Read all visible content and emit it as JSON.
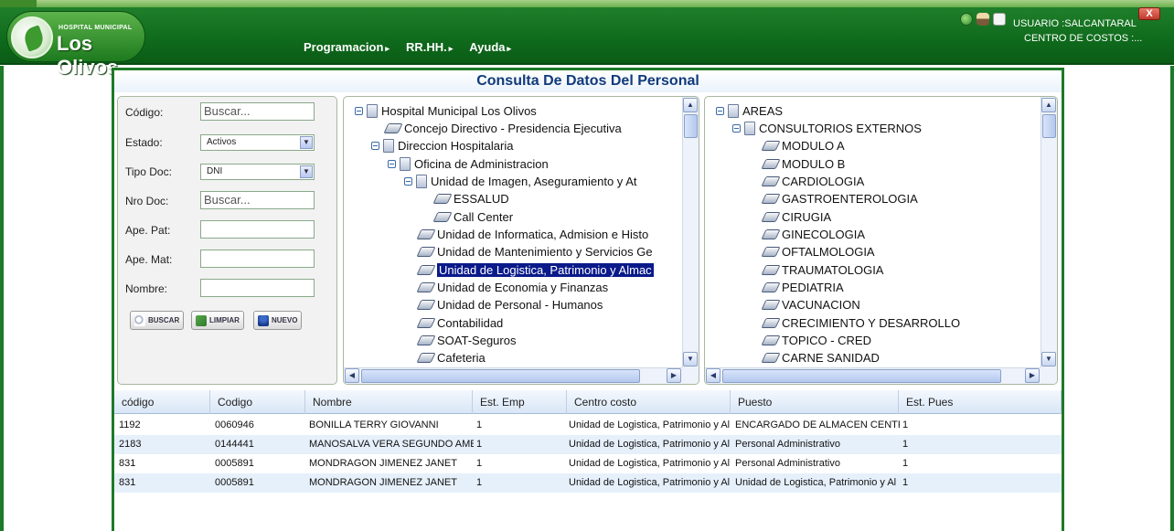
{
  "header": {
    "logo_small": "HOSPITAL MUNICIPAL",
    "logo_big": "Los Olivos",
    "menu": [
      {
        "label": "Programacion"
      },
      {
        "label": "RR.HH."
      },
      {
        "label": "Ayuda"
      }
    ],
    "user_label": "USUARIO :SALCANTARAL",
    "cost_center_label": "CENTRO DE COSTOS :...",
    "close_label": "X"
  },
  "main": {
    "title": "Consulta De Datos Del Personal"
  },
  "form": {
    "codigo_label": "Código:",
    "codigo_placeholder": "Buscar...",
    "estado_label": "Estado:",
    "estado_value": "Activos",
    "tipodoc_label": "Tipo Doc:",
    "tipodoc_value": "DNI",
    "nrodoc_label": "Nro Doc:",
    "nrodoc_placeholder": "Buscar...",
    "apepat_label": "Ape. Pat:",
    "apemat_label": "Ape. Mat:",
    "nombre_label": "Nombre:",
    "buscar_label": "BUSCAR",
    "limpiar_label": "LIMPIAR",
    "nuevo_label": "NUEVO"
  },
  "tree_org": [
    "Hospital Municipal Los Olivos",
    "Concejo Directivo - Presidencia Ejecutiva",
    "Direccion Hospitalaria",
    "Oficina de Administracion",
    "Unidad de Imagen, Aseguramiento y At",
    "ESSALUD",
    "Call Center",
    "Unidad de Informatica, Admision e Histo",
    "Unidad de Mantenimiento y Servicios Ge",
    "Unidad de Logistica, Patrimonio y Almac",
    "Unidad de Economia y Finanzas",
    "Unidad de Personal - Humanos",
    "Contabilidad",
    "SOAT-Seguros",
    "Cafeteria"
  ],
  "tree_areas": [
    "AREAS",
    "CONSULTORIOS EXTERNOS",
    "MODULO A",
    "MODULO B",
    "CARDIOLOGIA",
    "GASTROENTEROLOGIA",
    "CIRUGIA",
    "GINECOLOGIA",
    "OFTALMOLOGIA",
    "TRAUMATOLOGIA",
    "PEDIATRIA",
    "VACUNACION",
    "CRECIMIENTO Y DESARROLLO",
    "TOPICO - CRED",
    "CARNE SANIDAD"
  ],
  "grid": {
    "columns": [
      "código",
      "Codigo",
      "Nombre",
      "Est. Emp",
      "Centro costo",
      "Puesto",
      "Est. Pues"
    ],
    "rows": [
      [
        "1192",
        "0060946",
        "BONILLA TERRY GIOVANNI",
        "1",
        "Unidad de Logistica, Patrimonio y Al",
        "ENCARGADO DE ALMACEN CENTRA",
        "1"
      ],
      [
        "2183",
        "0144441",
        "MANOSALVA VERA SEGUNDO AMER",
        "1",
        "Unidad de Logistica, Patrimonio y Al",
        "Personal Administrativo",
        "1"
      ],
      [
        "831",
        "0005891",
        "MONDRAGON JIMENEZ JANET",
        "1",
        "Unidad de Logistica, Patrimonio y Al",
        "Personal Administrativo",
        "1"
      ],
      [
        "831",
        "0005891",
        "MONDRAGON JIMENEZ JANET",
        "1",
        "Unidad de Logistica, Patrimonio y Al",
        "Unidad de Logistica, Patrimonio y Al",
        "1"
      ]
    ]
  },
  "icons": {
    "globe": "globe-icon",
    "person": "person-icon",
    "lock": "lock-icon"
  }
}
